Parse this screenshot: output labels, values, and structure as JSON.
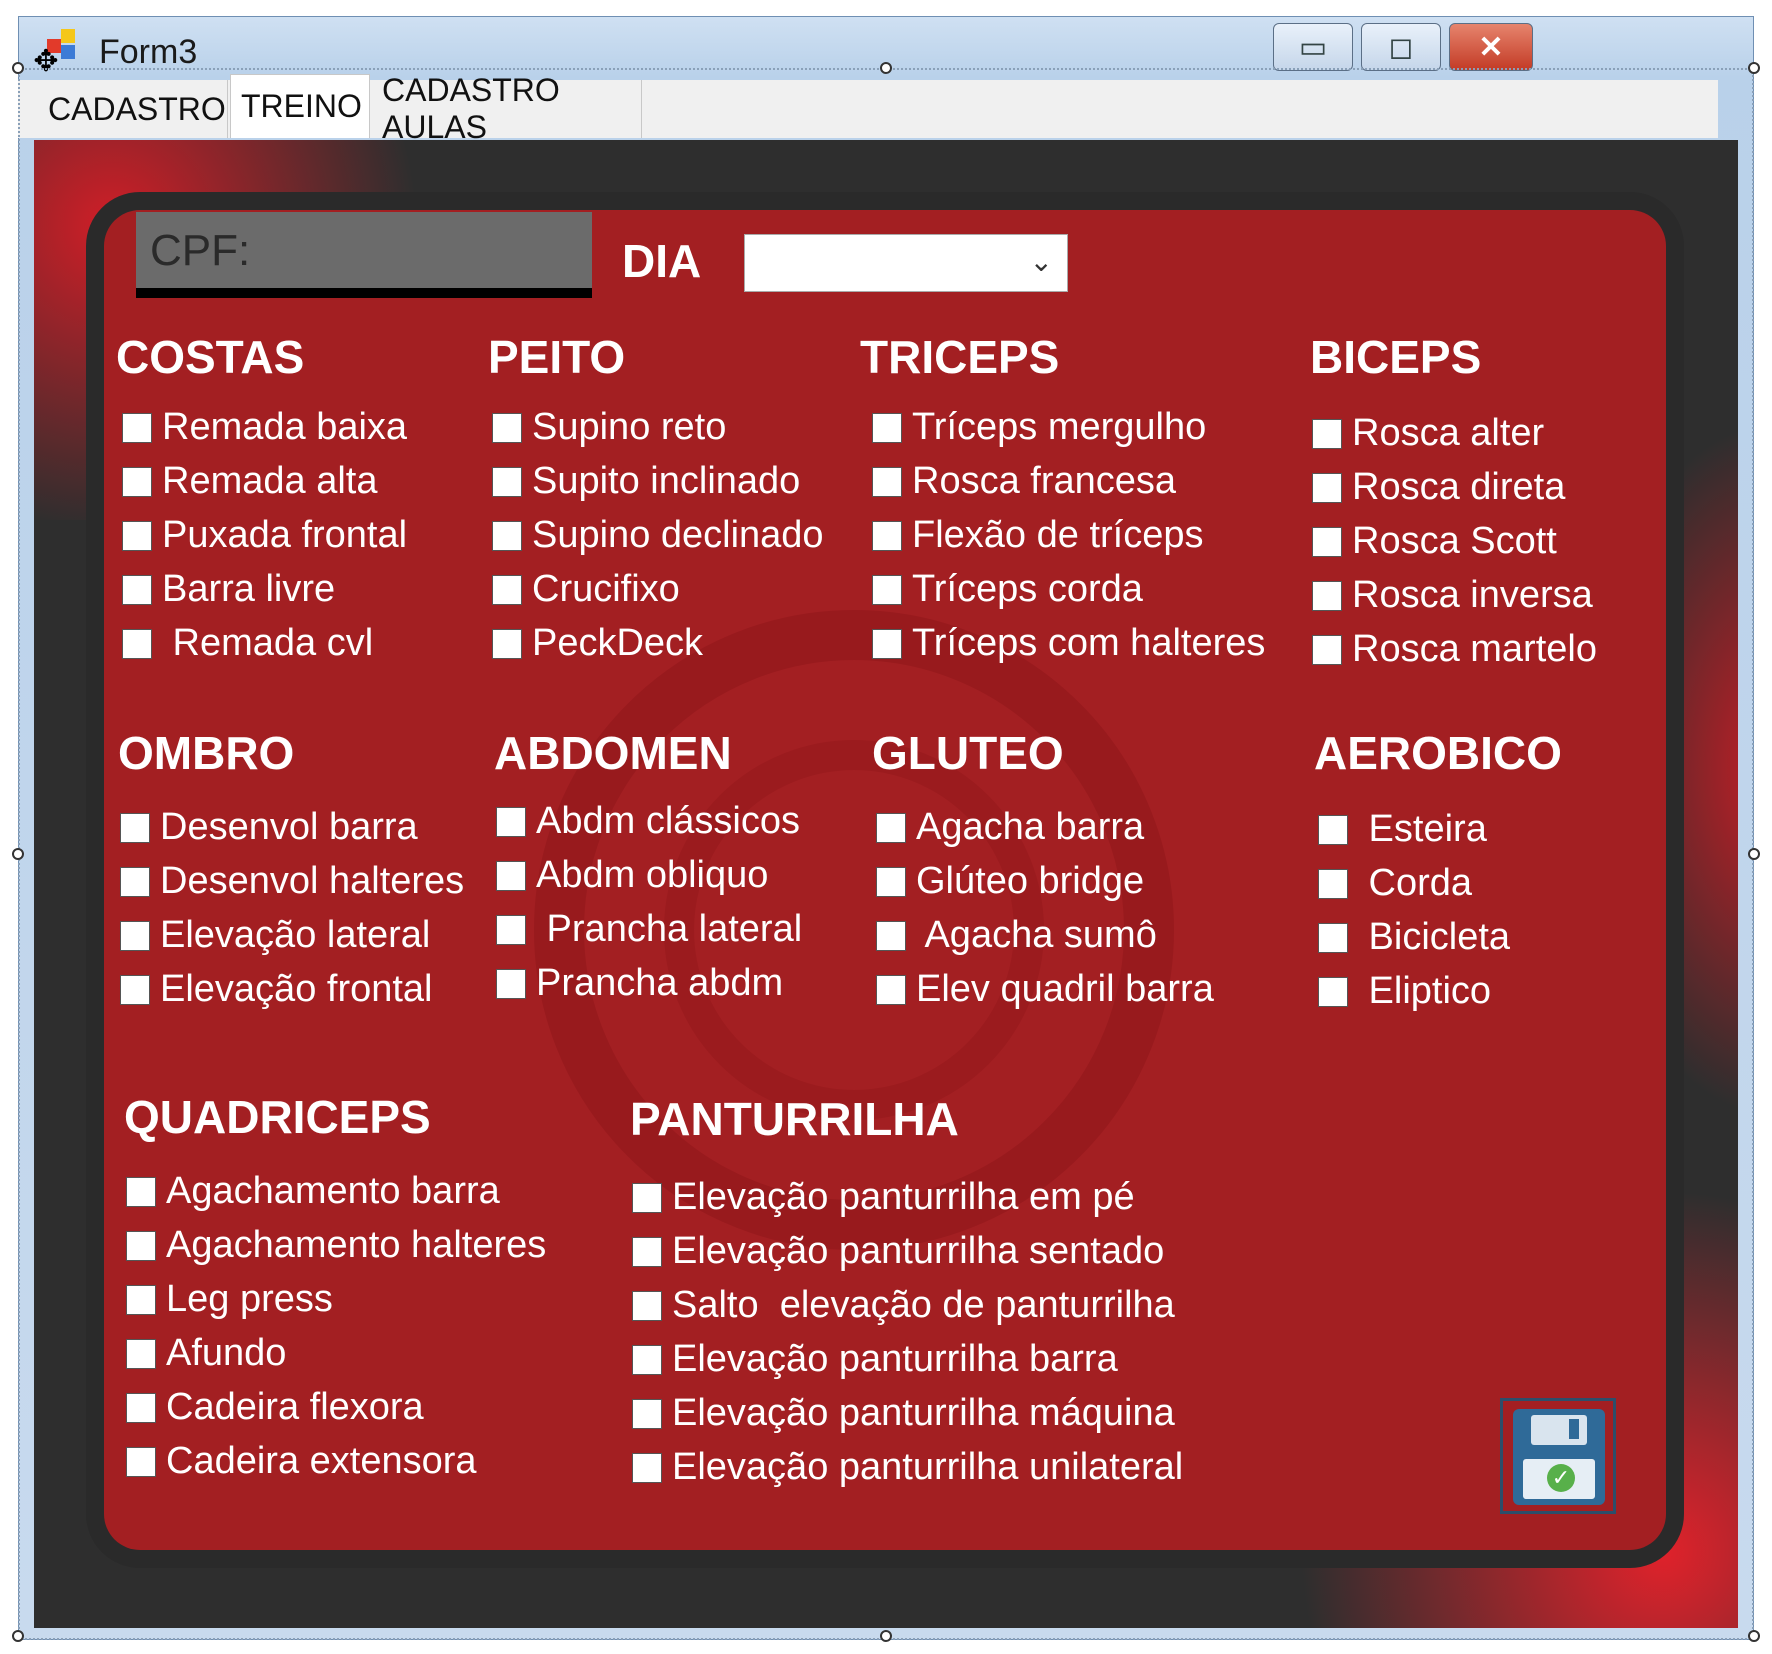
{
  "window": {
    "title": "Form3",
    "buttons": {
      "minimize": "▭",
      "maximize": "◻",
      "close": "✕"
    }
  },
  "tabs": [
    {
      "label": "CADASTRO"
    },
    {
      "label": "TREINO"
    },
    {
      "label": "CADASTRO AULAS"
    }
  ],
  "form": {
    "cpf_placeholder": "CPF:",
    "dia_label": "DIA",
    "dia_value": ""
  },
  "groups": {
    "costas": {
      "title": "COSTAS",
      "items": [
        "Remada baixa",
        "Remada alta",
        "Puxada frontal",
        "Barra livre",
        " Remada cvl"
      ]
    },
    "peito": {
      "title": "PEITO",
      "items": [
        "Supino reto",
        "Supito inclinado",
        "Supino declinado",
        "Crucifixo",
        "PeckDeck"
      ]
    },
    "triceps": {
      "title": "TRICEPS",
      "items": [
        "Tríceps mergulho",
        "Rosca francesa",
        "Flexão de tríceps",
        "Tríceps corda",
        "Tríceps com halteres"
      ]
    },
    "biceps": {
      "title": "BICEPS",
      "items": [
        "Rosca alter",
        "Rosca direta",
        "Rosca Scott",
        "Rosca inversa",
        "Rosca martelo"
      ]
    },
    "ombro": {
      "title": "OMBRO",
      "items": [
        "Desenvol barra",
        "Desenvol halteres",
        "Elevação lateral",
        "Elevação frontal"
      ]
    },
    "abdomen": {
      "title": "ABDOMEN",
      "items": [
        "Abdm clássicos",
        "Abdm obliquo",
        " Prancha lateral",
        "Prancha abdm"
      ]
    },
    "gluteo": {
      "title": "GLUTEO",
      "items": [
        "Agacha barra",
        "Glúteo bridge",
        " Agacha sumô",
        "Elev quadril barra"
      ]
    },
    "aerobico": {
      "title": "AEROBICO",
      "items": [
        " Esteira",
        " Corda",
        " Bicicleta",
        " Eliptico"
      ]
    },
    "quadriceps": {
      "title": "QUADRICEPS",
      "items": [
        "Agachamento barra",
        "Agachamento halteres",
        "Leg press",
        "Afundo",
        "Cadeira flexora",
        "Cadeira extensora"
      ]
    },
    "panturrilha": {
      "title": "PANTURRILHA",
      "items": [
        "Elevação panturrilha em pé",
        "Elevação panturrilha sentado",
        "Salto  elevação de panturrilha",
        "Elevação panturrilha barra",
        "Elevação panturrilha máquina",
        "Elevação panturrilha unilateral"
      ]
    }
  },
  "icons": {
    "save": "save-disk-icon",
    "app": "form-app-icon",
    "move": "move-cross-icon"
  },
  "colors": {
    "card": "#a31f22",
    "panel": "#2e2e2e",
    "accent_red": "#d01e27"
  }
}
